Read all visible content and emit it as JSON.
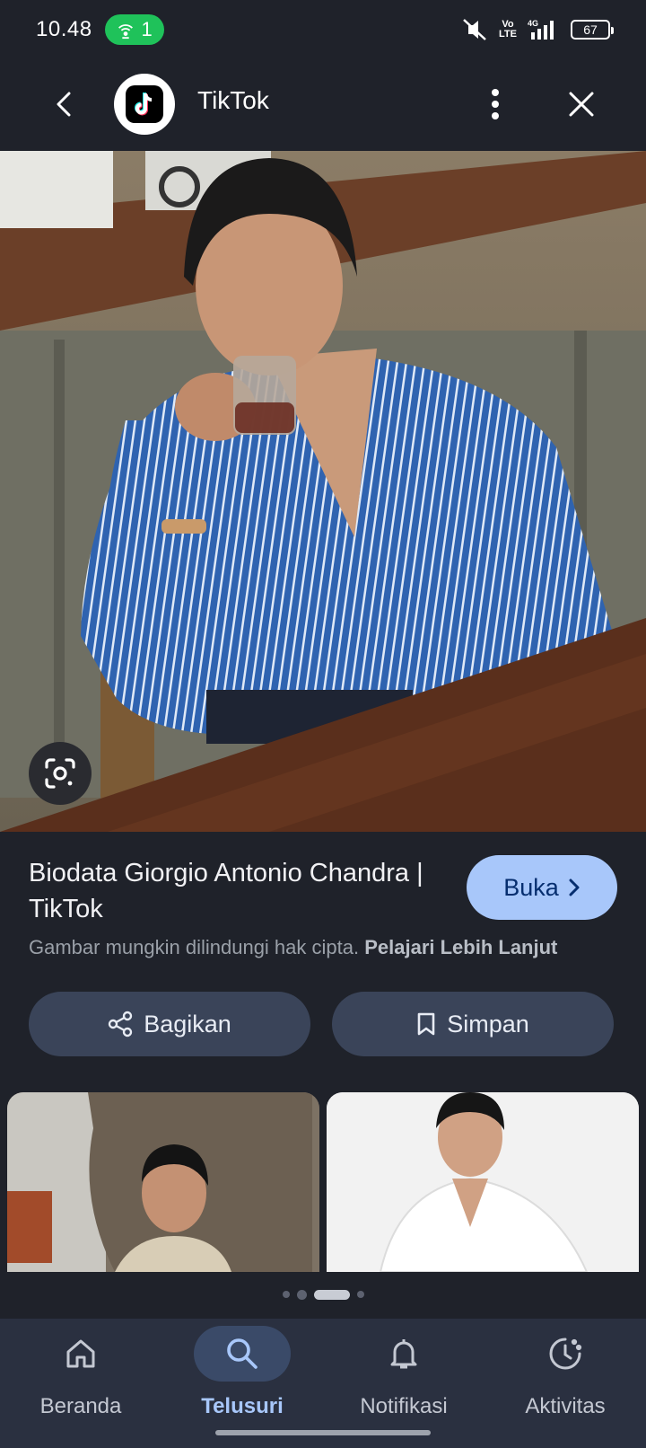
{
  "status_bar": {
    "time": "10.48",
    "hotspot_count": "1",
    "net_volte": "Vo LTE",
    "net_type": "4G",
    "battery": "67",
    "icons": [
      "mute-icon",
      "volte-icon",
      "signal-icon",
      "battery-icon"
    ]
  },
  "header": {
    "site_name": "TikTok",
    "icons": [
      "back-icon",
      "tiktok-logo",
      "more-vert-icon",
      "close-icon"
    ]
  },
  "result": {
    "title": "Biodata Giorgio Antonio Chandra | TikTok",
    "open_label": "Buka",
    "copyright_text": "Gambar mungkin dilindungi hak cipta.",
    "learn_more": "Pelajari Lebih Lanjut",
    "share_label": "Bagikan",
    "save_label": "Simpan"
  },
  "carousel": {
    "pages": 4,
    "active_index": 2
  },
  "nav": [
    {
      "label": "Beranda",
      "icon": "home-icon",
      "active": false
    },
    {
      "label": "Telusuri",
      "icon": "search-icon",
      "active": true
    },
    {
      "label": "Notifikasi",
      "icon": "bell-icon",
      "active": false
    },
    {
      "label": "Aktivitas",
      "icon": "activity-icon",
      "active": false
    }
  ],
  "colors": {
    "background": "#1f222a",
    "accent": "#a8c7fa",
    "hotspot": "#1fc25a",
    "button_bg": "#3a4459",
    "nav_bg": "#2a3040"
  }
}
